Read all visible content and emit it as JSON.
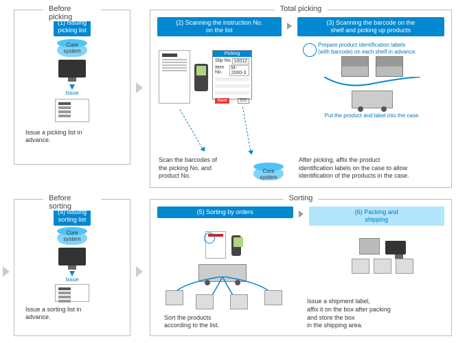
{
  "panels": {
    "before_picking": {
      "title": "Before picking",
      "step_label": "(1) Issuing\npicking list",
      "core_label": "Core\nsystem",
      "issue_label": "Issue",
      "caption": "Issue a picking list in\nadvance."
    },
    "total_picking": {
      "title": "Total picking",
      "step2_label": "(2) Scanning the instruction No.\non the list",
      "step3_label": "(3) Scanning the barcode on the\nshelf and picking up products",
      "note_top": "Prepare product identification labels\n(with barcode) on each shelf in advance.",
      "note_mid": "Put the product and label into the case.",
      "caption_left": "Scan the barcodes of\nthe picking No. and\nproduct No.",
      "caption_right": "After picking, affix the product\nidentification labels on the case to allow\nidentification of the products in the case.",
      "core_label": "Core\nsystem",
      "pick_screen": {
        "header": "Picking",
        "slip_label": "Slip No.",
        "slip_val": "10012",
        "item_label": "Item No.",
        "item_val": "M-2000-3",
        "back": "Back",
        "ent": "Ent"
      }
    },
    "before_sorting": {
      "title": "Before sorting",
      "step_label": "(4) Issuing\nsorting list",
      "core_label": "Core\nsystem",
      "issue_label": "Issue",
      "caption": "Issue a sorting list in\nadvance."
    },
    "sorting": {
      "title": "Sorting",
      "step5_label": "(5) Sorting by orders",
      "step6_label": "(6) Packing and\nshipping",
      "caption_left": "Sort the products\naccording to the list.",
      "caption_right": "Issue a shipment label,\naffix it on the box after packing\nand store the box\nin the shipping area."
    }
  }
}
